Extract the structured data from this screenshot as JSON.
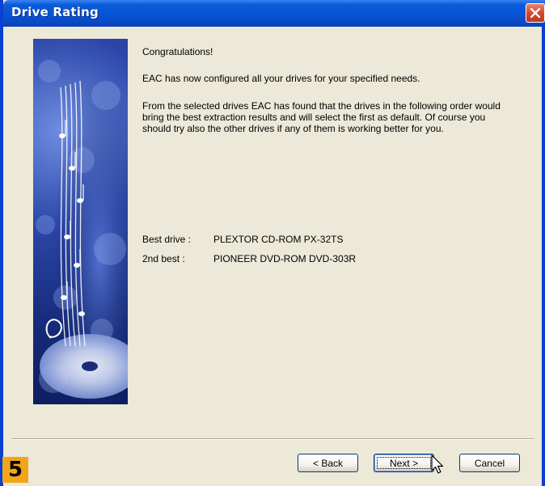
{
  "window": {
    "title": "Drive Rating",
    "close_icon": "close-icon"
  },
  "content": {
    "heading": "Congratulations!",
    "configured": "EAC has now configured all your drives for your specified needs.",
    "explanation": "From the selected drives EAC has found that the drives in the following order would bring the best extraction results and will select the first as default. Of course you should try also the other drives if any of them is working better for you.",
    "drives": [
      {
        "label": "Best drive :",
        "value": "PLEXTOR CD-ROM PX-32TS"
      },
      {
        "label": "2nd best :",
        "value": "PIONEER DVD-ROM DVD-303R"
      }
    ]
  },
  "buttons": {
    "back": "< Back",
    "next": "Next >",
    "cancel": "Cancel"
  },
  "step_badge": "5",
  "colors": {
    "titlebar": "#0654d6",
    "dialog_bg": "#ece9d8",
    "badge": "#f3a51a"
  },
  "icons": {
    "banner": "music-cd-banner-image",
    "cursor": "mouse-pointer-icon"
  }
}
